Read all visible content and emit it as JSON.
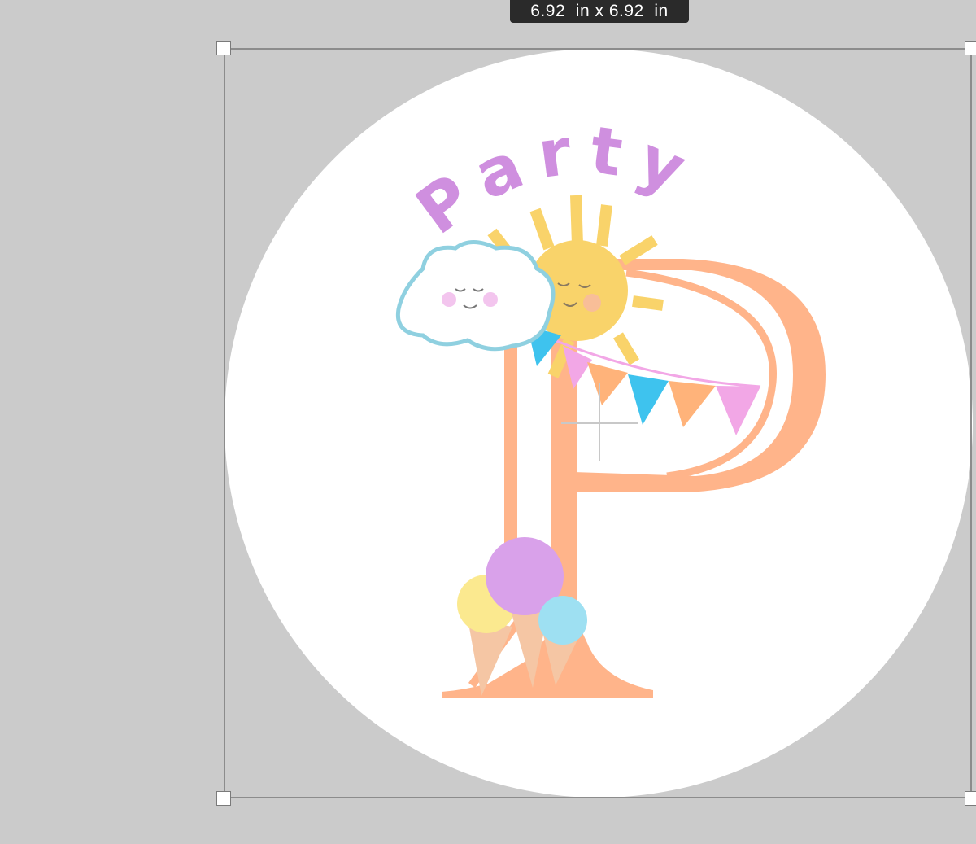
{
  "dimension_tooltip": {
    "width_value": "6.92",
    "height_value": "6.92",
    "unit": "in",
    "separator": "x"
  },
  "artwork": {
    "title_text": "Party",
    "colors": {
      "background": "#cbcbcb",
      "circle": "#ffffff",
      "letter": "#ffb48a",
      "title": "#cf8fdf",
      "sun": "#f9d36a",
      "cloud_outline": "#8fd0e0",
      "pennant_blue": "#3ec3ee",
      "pennant_pink": "#f2a7e6",
      "pennant_orange": "#ffb37a",
      "scoop_yellow": "#fbe98f",
      "scoop_purple": "#d9a1ea",
      "scoop_blue": "#9ee0f2",
      "cone": "#f5c6a4"
    }
  }
}
